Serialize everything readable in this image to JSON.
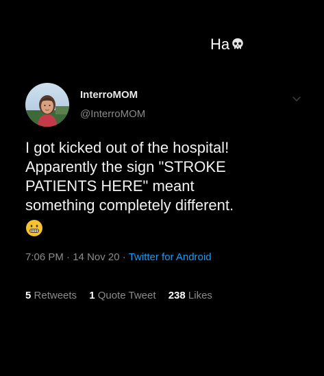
{
  "caption": {
    "text": "Ha",
    "icon": "skull-icon"
  },
  "tweet": {
    "author": {
      "display_name": "InterroMOM",
      "handle": "@InterroMOM",
      "avatar_icon": "avatar"
    },
    "text": "I got kicked out of the hospital!\nApparently the sign \"STROKE\nPATIENTS HERE\" meant\nsomething completely different.",
    "emoji_icon": "grimacing-face-icon",
    "time": "7:06 PM",
    "date": "14 Nov 20",
    "source": "Twitter for Android",
    "separator": "·",
    "stats": {
      "retweets": {
        "count": "5",
        "label": "Retweets"
      },
      "quote_tweets": {
        "count": "1",
        "label": "Quote Tweet"
      },
      "likes": {
        "count": "238",
        "label": "Likes"
      }
    }
  },
  "colors": {
    "background": "#000000",
    "text_primary": "#f2f2f2",
    "text_secondary": "#8b8b8b",
    "link": "#1d9bf0"
  }
}
